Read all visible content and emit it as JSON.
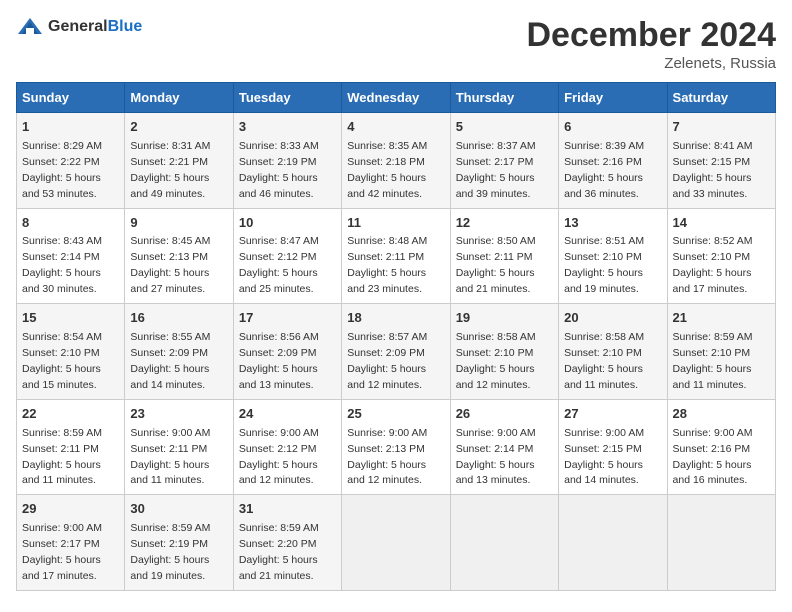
{
  "header": {
    "logo_general": "General",
    "logo_blue": "Blue",
    "month_title": "December 2024",
    "subtitle": "Zelenets, Russia"
  },
  "weekdays": [
    "Sunday",
    "Monday",
    "Tuesday",
    "Wednesday",
    "Thursday",
    "Friday",
    "Saturday"
  ],
  "weeks": [
    [
      {
        "day": "1",
        "info": "Sunrise: 8:29 AM\nSunset: 2:22 PM\nDaylight: 5 hours\nand 53 minutes."
      },
      {
        "day": "2",
        "info": "Sunrise: 8:31 AM\nSunset: 2:21 PM\nDaylight: 5 hours\nand 49 minutes."
      },
      {
        "day": "3",
        "info": "Sunrise: 8:33 AM\nSunset: 2:19 PM\nDaylight: 5 hours\nand 46 minutes."
      },
      {
        "day": "4",
        "info": "Sunrise: 8:35 AM\nSunset: 2:18 PM\nDaylight: 5 hours\nand 42 minutes."
      },
      {
        "day": "5",
        "info": "Sunrise: 8:37 AM\nSunset: 2:17 PM\nDaylight: 5 hours\nand 39 minutes."
      },
      {
        "day": "6",
        "info": "Sunrise: 8:39 AM\nSunset: 2:16 PM\nDaylight: 5 hours\nand 36 minutes."
      },
      {
        "day": "7",
        "info": "Sunrise: 8:41 AM\nSunset: 2:15 PM\nDaylight: 5 hours\nand 33 minutes."
      }
    ],
    [
      {
        "day": "8",
        "info": "Sunrise: 8:43 AM\nSunset: 2:14 PM\nDaylight: 5 hours\nand 30 minutes."
      },
      {
        "day": "9",
        "info": "Sunrise: 8:45 AM\nSunset: 2:13 PM\nDaylight: 5 hours\nand 27 minutes."
      },
      {
        "day": "10",
        "info": "Sunrise: 8:47 AM\nSunset: 2:12 PM\nDaylight: 5 hours\nand 25 minutes."
      },
      {
        "day": "11",
        "info": "Sunrise: 8:48 AM\nSunset: 2:11 PM\nDaylight: 5 hours\nand 23 minutes."
      },
      {
        "day": "12",
        "info": "Sunrise: 8:50 AM\nSunset: 2:11 PM\nDaylight: 5 hours\nand 21 minutes."
      },
      {
        "day": "13",
        "info": "Sunrise: 8:51 AM\nSunset: 2:10 PM\nDaylight: 5 hours\nand 19 minutes."
      },
      {
        "day": "14",
        "info": "Sunrise: 8:52 AM\nSunset: 2:10 PM\nDaylight: 5 hours\nand 17 minutes."
      }
    ],
    [
      {
        "day": "15",
        "info": "Sunrise: 8:54 AM\nSunset: 2:10 PM\nDaylight: 5 hours\nand 15 minutes."
      },
      {
        "day": "16",
        "info": "Sunrise: 8:55 AM\nSunset: 2:09 PM\nDaylight: 5 hours\nand 14 minutes."
      },
      {
        "day": "17",
        "info": "Sunrise: 8:56 AM\nSunset: 2:09 PM\nDaylight: 5 hours\nand 13 minutes."
      },
      {
        "day": "18",
        "info": "Sunrise: 8:57 AM\nSunset: 2:09 PM\nDaylight: 5 hours\nand 12 minutes."
      },
      {
        "day": "19",
        "info": "Sunrise: 8:58 AM\nSunset: 2:10 PM\nDaylight: 5 hours\nand 12 minutes."
      },
      {
        "day": "20",
        "info": "Sunrise: 8:58 AM\nSunset: 2:10 PM\nDaylight: 5 hours\nand 11 minutes."
      },
      {
        "day": "21",
        "info": "Sunrise: 8:59 AM\nSunset: 2:10 PM\nDaylight: 5 hours\nand 11 minutes."
      }
    ],
    [
      {
        "day": "22",
        "info": "Sunrise: 8:59 AM\nSunset: 2:11 PM\nDaylight: 5 hours\nand 11 minutes."
      },
      {
        "day": "23",
        "info": "Sunrise: 9:00 AM\nSunset: 2:11 PM\nDaylight: 5 hours\nand 11 minutes."
      },
      {
        "day": "24",
        "info": "Sunrise: 9:00 AM\nSunset: 2:12 PM\nDaylight: 5 hours\nand 12 minutes."
      },
      {
        "day": "25",
        "info": "Sunrise: 9:00 AM\nSunset: 2:13 PM\nDaylight: 5 hours\nand 12 minutes."
      },
      {
        "day": "26",
        "info": "Sunrise: 9:00 AM\nSunset: 2:14 PM\nDaylight: 5 hours\nand 13 minutes."
      },
      {
        "day": "27",
        "info": "Sunrise: 9:00 AM\nSunset: 2:15 PM\nDaylight: 5 hours\nand 14 minutes."
      },
      {
        "day": "28",
        "info": "Sunrise: 9:00 AM\nSunset: 2:16 PM\nDaylight: 5 hours\nand 16 minutes."
      }
    ],
    [
      {
        "day": "29",
        "info": "Sunrise: 9:00 AM\nSunset: 2:17 PM\nDaylight: 5 hours\nand 17 minutes."
      },
      {
        "day": "30",
        "info": "Sunrise: 8:59 AM\nSunset: 2:19 PM\nDaylight: 5 hours\nand 19 minutes."
      },
      {
        "day": "31",
        "info": "Sunrise: 8:59 AM\nSunset: 2:20 PM\nDaylight: 5 hours\nand 21 minutes."
      },
      {
        "day": "",
        "info": ""
      },
      {
        "day": "",
        "info": ""
      },
      {
        "day": "",
        "info": ""
      },
      {
        "day": "",
        "info": ""
      }
    ]
  ]
}
